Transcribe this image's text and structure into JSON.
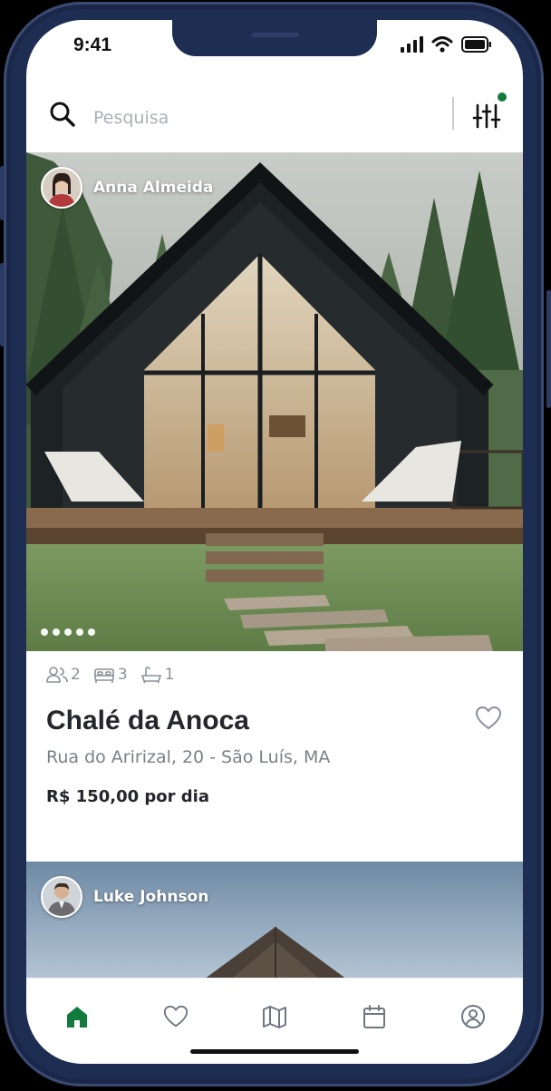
{
  "status_bar": {
    "time": "9:41"
  },
  "search": {
    "placeholder": "Pesquisa"
  },
  "listings": [
    {
      "owner": "Anna Almeida",
      "amenities": {
        "guests": "2",
        "beds": "3",
        "baths": "1"
      },
      "title": "Chalé da Anoca",
      "address": "Rua do Aririzal, 20 - São Luís, MA",
      "price": "R$ 150,00 por dia",
      "photo_count": 5
    },
    {
      "owner": "Luke Johnson"
    }
  ],
  "tabs": [
    "home-icon",
    "heart-icon",
    "map-icon",
    "calendar-icon",
    "profile-icon"
  ],
  "colors": {
    "accent": "#137a3e",
    "frame": "#1e2d52",
    "text": "#25262b",
    "muted": "#7b8089"
  }
}
